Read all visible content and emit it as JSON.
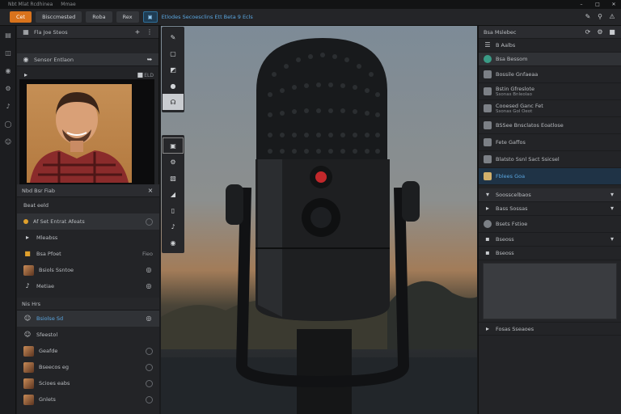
{
  "titlebar": {
    "items": [
      "Nbt Mlat Rcdhinea",
      "Mmae"
    ]
  },
  "toolbar": {
    "buttons": [
      "Cet",
      "Bisccmested",
      "Roba",
      "Rex"
    ],
    "breadcrumb": "Etlodes  Secoesclins  Ett Beta 9 Ecls",
    "colors": {
      "accent": "#d9731c",
      "select": "#2e6f9a"
    }
  },
  "left_panel": {
    "header": "Fla  Joe Steos",
    "cam_source": "Sensor Entlaon",
    "cam_badge": "ELD",
    "section1": "Nbd Bsr  Fiab",
    "items_a": [
      {
        "label": "Beat eeld",
        "sub": ""
      },
      {
        "label": "Af Set Entrat Afeats",
        "sub": ""
      },
      {
        "label": "Mleabss",
        "sub": ""
      },
      {
        "label": "Bsa Pfoet",
        "sub": "Fieo"
      },
      {
        "label": "Bsiols Ssntoe",
        "sub": ""
      },
      {
        "label": "Metiae",
        "sub": ""
      }
    ],
    "section2": "Nis Hrs",
    "items_b": [
      {
        "label": "Bsiolse  Sd",
        "sub": ""
      },
      {
        "label": "Sfeestol",
        "sub": ""
      },
      {
        "label": "Geafde",
        "sub": ""
      },
      {
        "label": "Bseecos eg",
        "sub": ""
      },
      {
        "label": "Scioes  eabs",
        "sub": ""
      },
      {
        "label": "Gnlets",
        "sub": ""
      }
    ]
  },
  "right_panel": {
    "header": "Bsa Mslebec",
    "sub": "B  Aalbs",
    "items": [
      {
        "label": "Bsa Bessom",
        "sub": ""
      },
      {
        "label": "Bossile Gnfaeaa",
        "sub": ""
      },
      {
        "label": "Bstin Gfreslote",
        "sub": "Ssonas Bnleolao"
      },
      {
        "label": "Cooesed Ganc Fet",
        "sub": "Ssonas  Gol Oeot"
      },
      {
        "label": "BSSee Bnsclatos Eoatlose",
        "sub": ""
      },
      {
        "label": "Fete Gaffos",
        "sub": ""
      },
      {
        "label": "Blatsto Ssnl  Sact Ssicsel",
        "sub": ""
      },
      {
        "label": "Fblees Goa",
        "sub": "",
        "highlight": true
      }
    ],
    "sec_a": "Soosscelbaos",
    "sec_b": "Bass Sossas",
    "sec_c": "Bsets Fstioe",
    "sec_d": "Bseoss",
    "footer": "Fosas Sseaoes"
  }
}
